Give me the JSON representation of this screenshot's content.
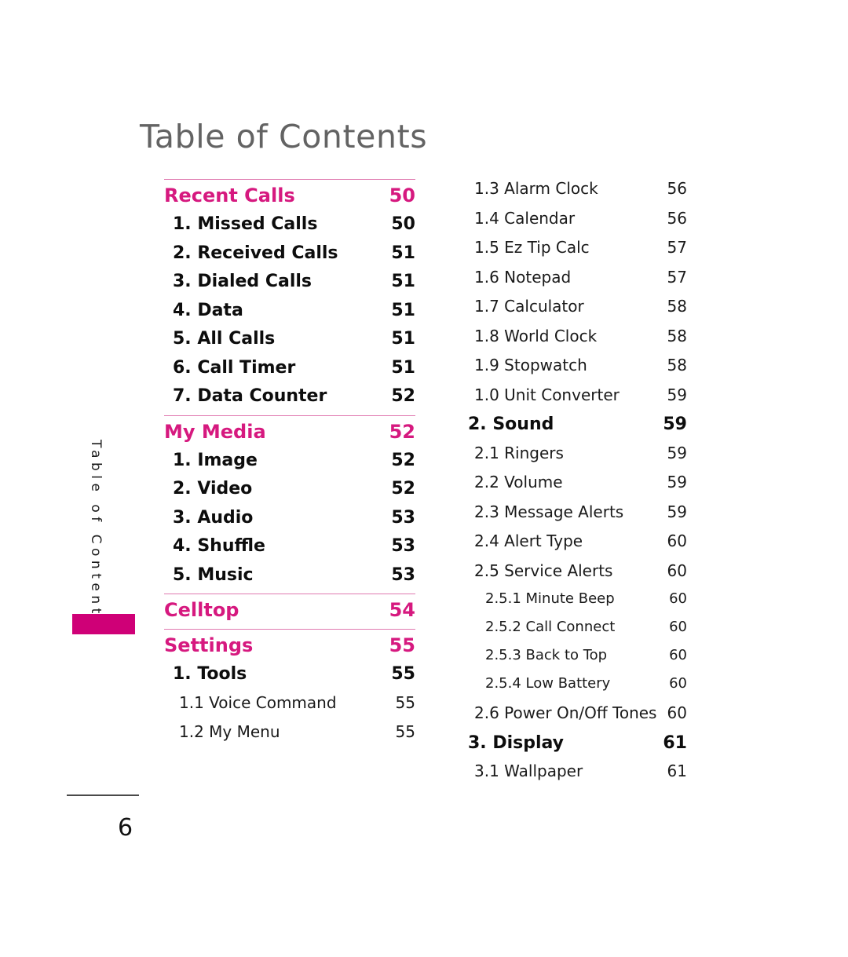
{
  "page": {
    "title": "Table of Contents",
    "folio": "6",
    "sidebar_label": "Table of Contents",
    "accent_magenta": "#d6197f",
    "tab_magenta": "#cf0077",
    "title_gray": "#636363",
    "divider_pink": "#e07ab0"
  },
  "left_column": [
    {
      "kind": "divider"
    },
    {
      "kind": "section",
      "label": "Recent Calls",
      "page": "50"
    },
    {
      "kind": "l1",
      "label": "1. Missed Calls",
      "page": "50"
    },
    {
      "kind": "l1",
      "label": "2. Received Calls",
      "page": "51"
    },
    {
      "kind": "l1",
      "label": "3. Dialed Calls",
      "page": "51"
    },
    {
      "kind": "l1",
      "label": "4. Data",
      "page": "51"
    },
    {
      "kind": "l1",
      "label": "5. All Calls",
      "page": "51"
    },
    {
      "kind": "l1",
      "label": "6. Call Timer",
      "page": "51"
    },
    {
      "kind": "l1",
      "label": "7. Data Counter",
      "page": "52"
    },
    {
      "kind": "divider"
    },
    {
      "kind": "section",
      "label": "My Media",
      "page": "52"
    },
    {
      "kind": "l1",
      "label": "1. Image",
      "page": "52"
    },
    {
      "kind": "l1",
      "label": "2. Video",
      "page": "52"
    },
    {
      "kind": "l1",
      "label": "3. Audio",
      "page": "53"
    },
    {
      "kind": "l1",
      "label": "4. Shuffle",
      "page": "53"
    },
    {
      "kind": "l1",
      "label": "5. Music",
      "page": "53"
    },
    {
      "kind": "divider"
    },
    {
      "kind": "section",
      "label": "Celltop",
      "page": "54"
    },
    {
      "kind": "divider"
    },
    {
      "kind": "section",
      "label": "Settings",
      "page": "55"
    },
    {
      "kind": "l1",
      "label": "1. Tools",
      "page": "55"
    },
    {
      "kind": "l2",
      "label": "1.1 Voice Command",
      "page": "55"
    },
    {
      "kind": "l2",
      "label": "1.2 My Menu",
      "page": "55"
    }
  ],
  "right_column": [
    {
      "kind": "l2",
      "label": "1.3 Alarm Clock",
      "page": "56"
    },
    {
      "kind": "l2",
      "label": "1.4 Calendar",
      "page": "56"
    },
    {
      "kind": "l2",
      "label": "1.5 Ez Tip Calc",
      "page": "57"
    },
    {
      "kind": "l2",
      "label": "1.6 Notepad",
      "page": "57"
    },
    {
      "kind": "l2",
      "label": "1.7 Calculator",
      "page": "58"
    },
    {
      "kind": "l2",
      "label": "1.8 World Clock",
      "page": "58"
    },
    {
      "kind": "l2",
      "label": "1.9 Stopwatch",
      "page": "58"
    },
    {
      "kind": "l2",
      "label": "1.0 Unit Converter",
      "page": "59"
    },
    {
      "kind": "l1",
      "label": "2. Sound",
      "page": "59"
    },
    {
      "kind": "l2",
      "label": "2.1 Ringers",
      "page": "59"
    },
    {
      "kind": "l2",
      "label": "2.2 Volume",
      "page": "59"
    },
    {
      "kind": "l2",
      "label": "2.3 Message Alerts",
      "page": "59"
    },
    {
      "kind": "l2",
      "label": "2.4 Alert Type",
      "page": "60"
    },
    {
      "kind": "l2",
      "label": "2.5 Service Alerts",
      "page": "60"
    },
    {
      "kind": "l3",
      "label": "2.5.1 Minute Beep",
      "page": "60"
    },
    {
      "kind": "l3",
      "label": "2.5.2 Call Connect",
      "page": "60"
    },
    {
      "kind": "l3",
      "label": "2.5.3 Back to Top",
      "page": "60"
    },
    {
      "kind": "l3",
      "label": "2.5.4 Low Battery",
      "page": "60"
    },
    {
      "kind": "l2",
      "label": "2.6 Power On/Off Tones",
      "page": "60"
    },
    {
      "kind": "l1",
      "label": "3. Display",
      "page": "61"
    },
    {
      "kind": "l2",
      "label": "3.1 Wallpaper",
      "page": "61"
    }
  ]
}
